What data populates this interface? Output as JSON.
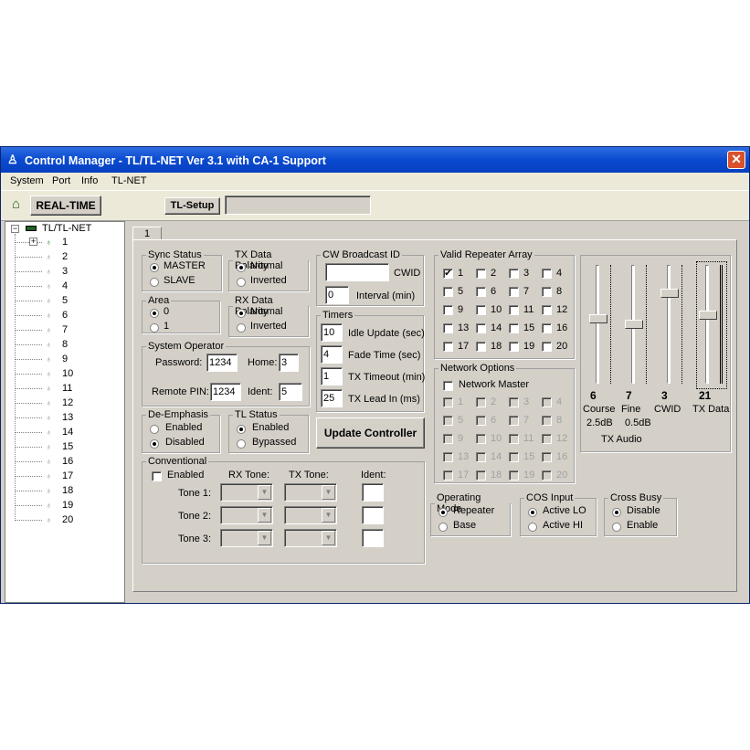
{
  "window": {
    "title": "Control Manager - TL/TL-NET Ver 3.1 with CA-1 Support",
    "close": "✕"
  },
  "menu": [
    "System",
    "Port",
    "Info",
    "TL-NET"
  ],
  "toolbar": {
    "realtime": "REAL-TIME",
    "tlsetup": "TL-Setup"
  },
  "tree": {
    "root": "TL/TL-NET",
    "nodes": [
      "1",
      "2",
      "3",
      "4",
      "5",
      "6",
      "7",
      "8",
      "9",
      "10",
      "11",
      "12",
      "13",
      "14",
      "15",
      "16",
      "17",
      "18",
      "19",
      "20"
    ]
  },
  "tab": "1",
  "sync": {
    "legend": "Sync Status",
    "opts": [
      "MASTER",
      "SLAVE"
    ],
    "selected": 0
  },
  "txpol": {
    "legend": "TX Data Polarity",
    "opts": [
      "Normal",
      "Inverted"
    ],
    "selected": 0
  },
  "area": {
    "legend": "Area",
    "opts": [
      "0",
      "1"
    ],
    "selected": 0
  },
  "rxpol": {
    "legend": "RX Data Polarity",
    "opts": [
      "Normal",
      "Inverted"
    ],
    "selected": 0
  },
  "sysop": {
    "legend": "System Operator",
    "password_label": "Password:",
    "password": "1234",
    "home_label": "Home:",
    "home": "3",
    "pin_label": "Remote PIN:",
    "pin": "1234",
    "ident_label": "Ident:",
    "ident": "5"
  },
  "deemph": {
    "legend": "De-Emphasis",
    "opts": [
      "Enabled",
      "Disabled"
    ],
    "selected": 1
  },
  "tlstatus": {
    "legend": "TL Status",
    "opts": [
      "Enabled",
      "Bypassed"
    ],
    "selected": 0
  },
  "conv": {
    "legend": "Conventional",
    "enabled": "Enabled",
    "rx": "RX Tone:",
    "tx": "TX Tone:",
    "ident": "Ident:",
    "tones": [
      "Tone 1:",
      "Tone 2:",
      "Tone 3:"
    ]
  },
  "cw": {
    "legend": "CW Broadcast ID",
    "cwid": "CWID",
    "cwid_value": "",
    "interval_label": "Interval (min)",
    "interval": "0"
  },
  "timers": {
    "legend": "Timers",
    "rows": [
      {
        "v": "10",
        "l": "Idle Update (sec)"
      },
      {
        "v": "4",
        "l": "Fade Time (sec)"
      },
      {
        "v": "1",
        "l": "TX Timeout (min)"
      },
      {
        "v": "25",
        "l": "TX Lead In (ms)"
      }
    ]
  },
  "update": "Update Controller",
  "vra": {
    "legend": "Valid Repeater Array",
    "checked": [
      "1"
    ]
  },
  "net": {
    "legend": "Network Options",
    "master": "Network Master"
  },
  "repeaters": [
    "1",
    "2",
    "3",
    "4",
    "5",
    "6",
    "7",
    "8",
    "9",
    "10",
    "11",
    "12",
    "13",
    "14",
    "15",
    "16",
    "17",
    "18",
    "19",
    "20"
  ],
  "opmode": {
    "legend": "Operating Mode",
    "opts": [
      "Repeater",
      "Base"
    ],
    "selected": 0
  },
  "cos": {
    "legend": "COS Input",
    "opts": [
      "Active LO",
      "Active HI"
    ],
    "selected": 0
  },
  "crossbusy": {
    "legend": "Cross Busy",
    "opts": [
      "Disable",
      "Enable"
    ],
    "selected": 0
  },
  "audio": {
    "title": "TX Audio",
    "sliders": [
      {
        "value": "6",
        "label": "Course",
        "sub": "2.5dB",
        "level": 0.45
      },
      {
        "value": "7",
        "label": "Fine",
        "sub": "0.5dB",
        "level": 0.5
      },
      {
        "value": "3",
        "label": "CWID",
        "sub": "",
        "level": 0.22
      },
      {
        "value": "21",
        "label": "TX Data",
        "sub": "",
        "level": 0.42
      }
    ]
  }
}
